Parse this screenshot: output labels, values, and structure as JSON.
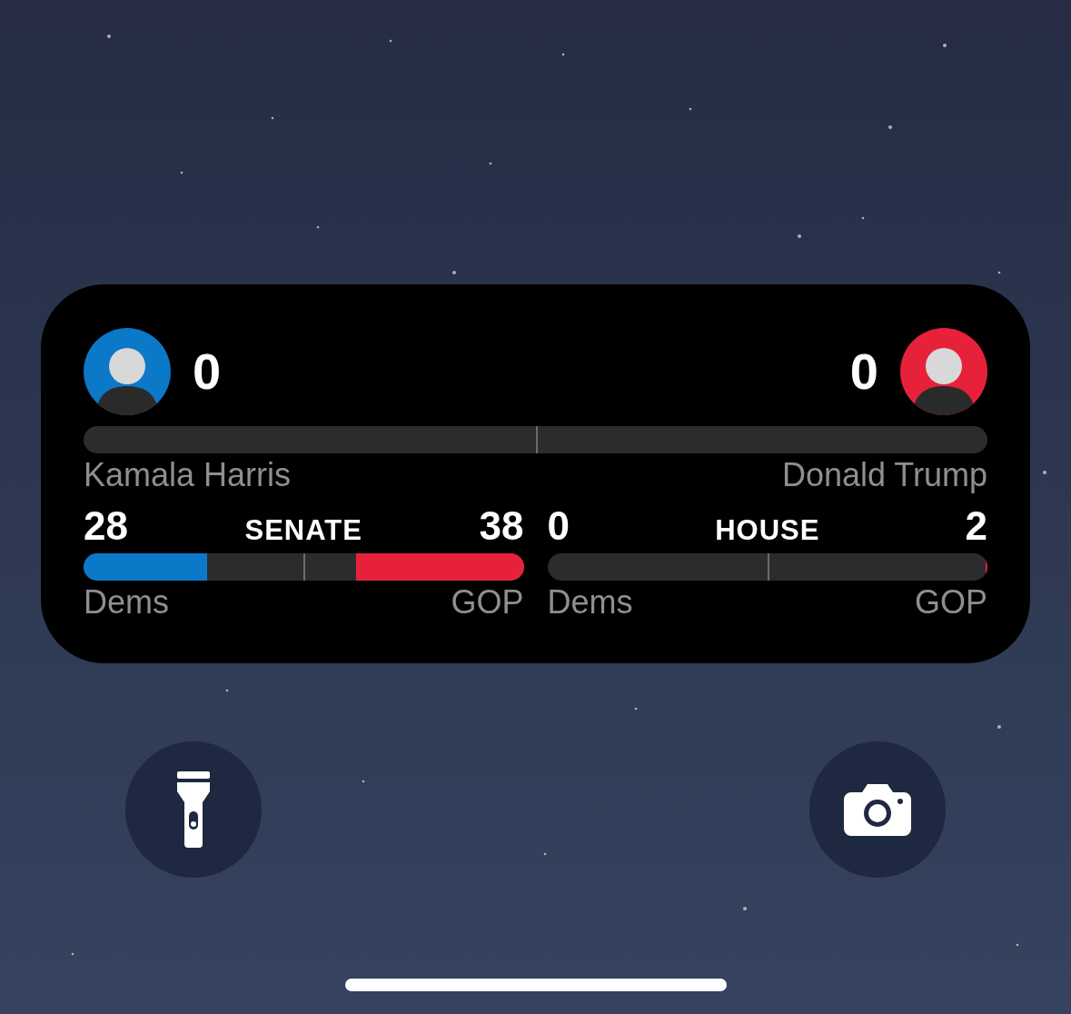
{
  "president": {
    "candidates": [
      {
        "name": "Kamala Harris",
        "votes": "0",
        "color": "#0b78c8"
      },
      {
        "name": "Donald Trump",
        "votes": "0",
        "color": "#e8213b"
      }
    ]
  },
  "races": [
    {
      "title": "SENATE",
      "sides": [
        {
          "count": "28",
          "label": "Dems",
          "level": 0.28,
          "color": "#0b78c8"
        },
        {
          "count": "38",
          "label": "GOP",
          "level": 0.38,
          "color": "#e8213b"
        }
      ]
    },
    {
      "title": "HOUSE",
      "sides": [
        {
          "count": "0",
          "label": "Dems"
        },
        {
          "count": "2",
          "label": "GOP",
          "level": 0.005,
          "color": "#e8213b"
        }
      ]
    }
  ],
  "buttons": [
    {
      "kind": "flashlight"
    },
    {
      "kind": "camera"
    }
  ]
}
